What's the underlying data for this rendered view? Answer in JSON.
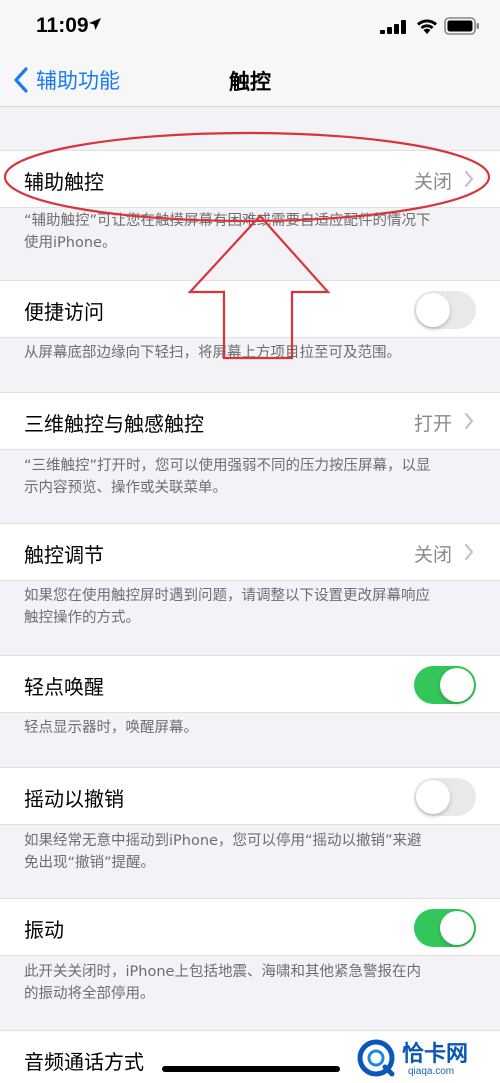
{
  "status_bar": {
    "time": "11:09"
  },
  "nav": {
    "back_label": "辅助功能",
    "title": "触控"
  },
  "sections": [
    {
      "label": "辅助触控",
      "value": "关闭",
      "control": "chevron",
      "footer": [
        "“辅助触控”可让您在触摸屏幕有困难或需要自适应配件的情况下",
        "使用iPhone。"
      ]
    },
    {
      "label": "便捷访问",
      "control": "toggle",
      "state": "off",
      "footer": [
        "从屏幕底部边缘向下轻扫，将屏幕上方项目拉至可及范围。"
      ]
    },
    {
      "label": "三维触控与触感触控",
      "value": "打开",
      "control": "chevron",
      "footer": [
        "“三维触控”打开时，您可以使用强弱不同的压力按压屏幕，以显",
        "示内容预览、操作或关联菜单。"
      ]
    },
    {
      "label": "触控调节",
      "value": "关闭",
      "control": "chevron",
      "footer": [
        "如果您在使用触控屏时遇到问题，请调整以下设置更改屏幕响应",
        "触控操作的方式。"
      ]
    },
    {
      "label": "轻点唤醒",
      "control": "toggle",
      "state": "on",
      "footer": [
        "轻点显示器时，唤醒屏幕。"
      ]
    },
    {
      "label": "摇动以撤销",
      "control": "toggle",
      "state": "off",
      "footer": [
        "如果经常无意中摇动到iPhone，您可以停用“摇动以撤销”来避",
        "免出现“撤销”提醒。"
      ]
    },
    {
      "label": "振动",
      "control": "toggle",
      "state": "on",
      "footer": [
        "此开关关闭时，iPhone上包括地震、海啸和其他紧急警报在内",
        "的振动将全部停用。"
      ]
    },
    {
      "label": "音频通话方式",
      "control": "none"
    }
  ],
  "watermark": {
    "text": "恰卡网",
    "sub": "qiaqa.com"
  },
  "colors": {
    "accent": "#1b7bf4",
    "toggle_on": "#33c759",
    "toggle_off": "#e9e9eb",
    "annotation": "#d9343a"
  }
}
